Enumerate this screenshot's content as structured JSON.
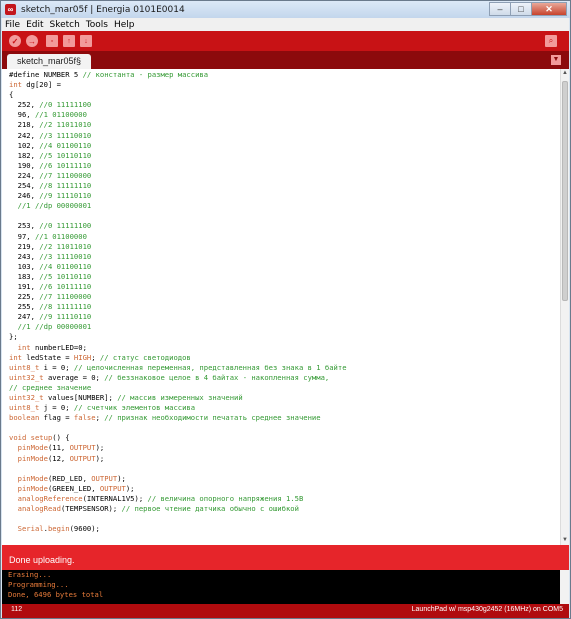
{
  "window": {
    "title": "sketch_mar05f | Energia 0101E0014",
    "controls": {
      "minimize": "–",
      "maximize": "□",
      "close": "✕"
    }
  },
  "menu": [
    "File",
    "Edit",
    "Sketch",
    "Tools",
    "Help"
  ],
  "toolbar": {
    "verify_icon": "check-icon",
    "upload_icon": "arrow-right-icon",
    "new_icon": "new-file-icon",
    "open_icon": "arrow-up-icon",
    "save_icon": "arrow-down-icon",
    "serial_icon": "magnifier-icon"
  },
  "tab": {
    "label": "sketch_mar05f§"
  },
  "editor": {
    "lines": [
      [
        {
          "t": "#define NUMBER 5 ",
          "c": ""
        },
        {
          "t": "// константа - размер массива",
          "c": "cm"
        }
      ],
      [
        {
          "t": "int",
          "c": "ty"
        },
        {
          "t": " dg[20] =",
          "c": ""
        }
      ],
      [
        {
          "t": "{",
          "c": ""
        }
      ],
      [
        {
          "t": "  252, ",
          "c": ""
        },
        {
          "t": "//0 11111100",
          "c": "cm"
        }
      ],
      [
        {
          "t": "  96, ",
          "c": ""
        },
        {
          "t": "//1 01100000",
          "c": "cm"
        }
      ],
      [
        {
          "t": "  218, ",
          "c": ""
        },
        {
          "t": "//2 11011010",
          "c": "cm"
        }
      ],
      [
        {
          "t": "  242, ",
          "c": ""
        },
        {
          "t": "//3 11110010",
          "c": "cm"
        }
      ],
      [
        {
          "t": "  102, ",
          "c": ""
        },
        {
          "t": "//4 01100110",
          "c": "cm"
        }
      ],
      [
        {
          "t": "  182, ",
          "c": ""
        },
        {
          "t": "//5 10110110",
          "c": "cm"
        }
      ],
      [
        {
          "t": "  190, ",
          "c": ""
        },
        {
          "t": "//6 10111110",
          "c": "cm"
        }
      ],
      [
        {
          "t": "  224, ",
          "c": ""
        },
        {
          "t": "//7 11100000",
          "c": "cm"
        }
      ],
      [
        {
          "t": "  254, ",
          "c": ""
        },
        {
          "t": "//8 11111110",
          "c": "cm"
        }
      ],
      [
        {
          "t": "  246, ",
          "c": ""
        },
        {
          "t": "//9 11110110",
          "c": "cm"
        }
      ],
      [
        {
          "t": "  ",
          "c": ""
        },
        {
          "t": "//1 //dp 00000001",
          "c": "cm"
        }
      ],
      [
        {
          "t": "",
          "c": ""
        }
      ],
      [
        {
          "t": "  253, ",
          "c": ""
        },
        {
          "t": "//0 11111100",
          "c": "cm"
        }
      ],
      [
        {
          "t": "  97, ",
          "c": ""
        },
        {
          "t": "//1 01100000",
          "c": "cm"
        }
      ],
      [
        {
          "t": "  219, ",
          "c": ""
        },
        {
          "t": "//2 11011010",
          "c": "cm"
        }
      ],
      [
        {
          "t": "  243, ",
          "c": ""
        },
        {
          "t": "//3 11110010",
          "c": "cm"
        }
      ],
      [
        {
          "t": "  103, ",
          "c": ""
        },
        {
          "t": "//4 01100110",
          "c": "cm"
        }
      ],
      [
        {
          "t": "  183, ",
          "c": ""
        },
        {
          "t": "//5 10110110",
          "c": "cm"
        }
      ],
      [
        {
          "t": "  191, ",
          "c": ""
        },
        {
          "t": "//6 10111110",
          "c": "cm"
        }
      ],
      [
        {
          "t": "  225, ",
          "c": ""
        },
        {
          "t": "//7 11100000",
          "c": "cm"
        }
      ],
      [
        {
          "t": "  255, ",
          "c": ""
        },
        {
          "t": "//8 11111110",
          "c": "cm"
        }
      ],
      [
        {
          "t": "  247, ",
          "c": ""
        },
        {
          "t": "//9 11110110",
          "c": "cm"
        }
      ],
      [
        {
          "t": "  ",
          "c": ""
        },
        {
          "t": "//1 //dp 00000001",
          "c": "cm"
        }
      ],
      [
        {
          "t": "};",
          "c": ""
        }
      ],
      [
        {
          "t": "  ",
          "c": ""
        },
        {
          "t": "int",
          "c": "ty"
        },
        {
          "t": " numberLED=0;",
          "c": ""
        }
      ],
      [
        {
          "t": "int",
          "c": "ty"
        },
        {
          "t": " ledState = ",
          "c": ""
        },
        {
          "t": "HIGH",
          "c": "kw"
        },
        {
          "t": "; ",
          "c": ""
        },
        {
          "t": "// статус светодиодов",
          "c": "cm"
        }
      ],
      [
        {
          "t": "uint8_t",
          "c": "ty"
        },
        {
          "t": " i = 0; ",
          "c": ""
        },
        {
          "t": "// целочисленная переменная, представленная без знака в 1 байте",
          "c": "cm"
        }
      ],
      [
        {
          "t": "uint32_t",
          "c": "ty"
        },
        {
          "t": " average = 0; ",
          "c": ""
        },
        {
          "t": "// беззнаковое целое в 4 байтах - накопленная сумма,",
          "c": "cm"
        }
      ],
      [
        {
          "t": "// среднее значение",
          "c": "cm"
        }
      ],
      [
        {
          "t": "uint32_t",
          "c": "ty"
        },
        {
          "t": " values[NUMBER]; ",
          "c": ""
        },
        {
          "t": "// массив измеренных значений",
          "c": "cm"
        }
      ],
      [
        {
          "t": "uint8_t",
          "c": "ty"
        },
        {
          "t": " j = 0; ",
          "c": ""
        },
        {
          "t": "// счетчик элементов массива",
          "c": "cm"
        }
      ],
      [
        {
          "t": "boolean",
          "c": "ty"
        },
        {
          "t": " flag = ",
          "c": ""
        },
        {
          "t": "false",
          "c": "kw"
        },
        {
          "t": "; ",
          "c": ""
        },
        {
          "t": "// признак необходимости печатать среднее значение",
          "c": "cm"
        }
      ],
      [
        {
          "t": "",
          "c": ""
        }
      ],
      [
        {
          "t": "void",
          "c": "ty"
        },
        {
          "t": " ",
          "c": ""
        },
        {
          "t": "setup",
          "c": "fn"
        },
        {
          "t": "() {",
          "c": ""
        }
      ],
      [
        {
          "t": "  ",
          "c": ""
        },
        {
          "t": "pinMode",
          "c": "fn"
        },
        {
          "t": "(11, ",
          "c": ""
        },
        {
          "t": "OUTPUT",
          "c": "kw"
        },
        {
          "t": ");",
          "c": ""
        }
      ],
      [
        {
          "t": "  ",
          "c": ""
        },
        {
          "t": "pinMode",
          "c": "fn"
        },
        {
          "t": "(12, ",
          "c": ""
        },
        {
          "t": "OUTPUT",
          "c": "kw"
        },
        {
          "t": ");",
          "c": ""
        }
      ],
      [
        {
          "t": "",
          "c": ""
        }
      ],
      [
        {
          "t": "  ",
          "c": ""
        },
        {
          "t": "pinMode",
          "c": "fn"
        },
        {
          "t": "(RED_LED, ",
          "c": ""
        },
        {
          "t": "OUTPUT",
          "c": "kw"
        },
        {
          "t": ");",
          "c": ""
        }
      ],
      [
        {
          "t": "  ",
          "c": ""
        },
        {
          "t": "pinMode",
          "c": "fn"
        },
        {
          "t": "(GREEN_LED, ",
          "c": ""
        },
        {
          "t": "OUTPUT",
          "c": "kw"
        },
        {
          "t": ");",
          "c": ""
        }
      ],
      [
        {
          "t": "  ",
          "c": ""
        },
        {
          "t": "analogReference",
          "c": "fn"
        },
        {
          "t": "(INTERNAL1V5); ",
          "c": ""
        },
        {
          "t": "// величина опорного напряжения 1.5В",
          "c": "cm"
        }
      ],
      [
        {
          "t": "  ",
          "c": ""
        },
        {
          "t": "analogRead",
          "c": "fn"
        },
        {
          "t": "(TEMPSENSOR); ",
          "c": ""
        },
        {
          "t": "// первое чтение датчика обычно с ошибкой",
          "c": "cm"
        }
      ],
      [
        {
          "t": "",
          "c": ""
        }
      ],
      [
        {
          "t": "  ",
          "c": ""
        },
        {
          "t": "Serial",
          "c": "kw"
        },
        {
          "t": ".",
          "c": ""
        },
        {
          "t": "begin",
          "c": "fn"
        },
        {
          "t": "(9600);",
          "c": ""
        }
      ]
    ]
  },
  "status": {
    "message": "Done uploading."
  },
  "console": {
    "lines": [
      "Erasing...",
      "Programming...",
      "Done, 6496 bytes total"
    ]
  },
  "footer": {
    "line_number": "112",
    "board": "LaunchPad w/ msp430g2452 (16MHz) on COM5"
  }
}
